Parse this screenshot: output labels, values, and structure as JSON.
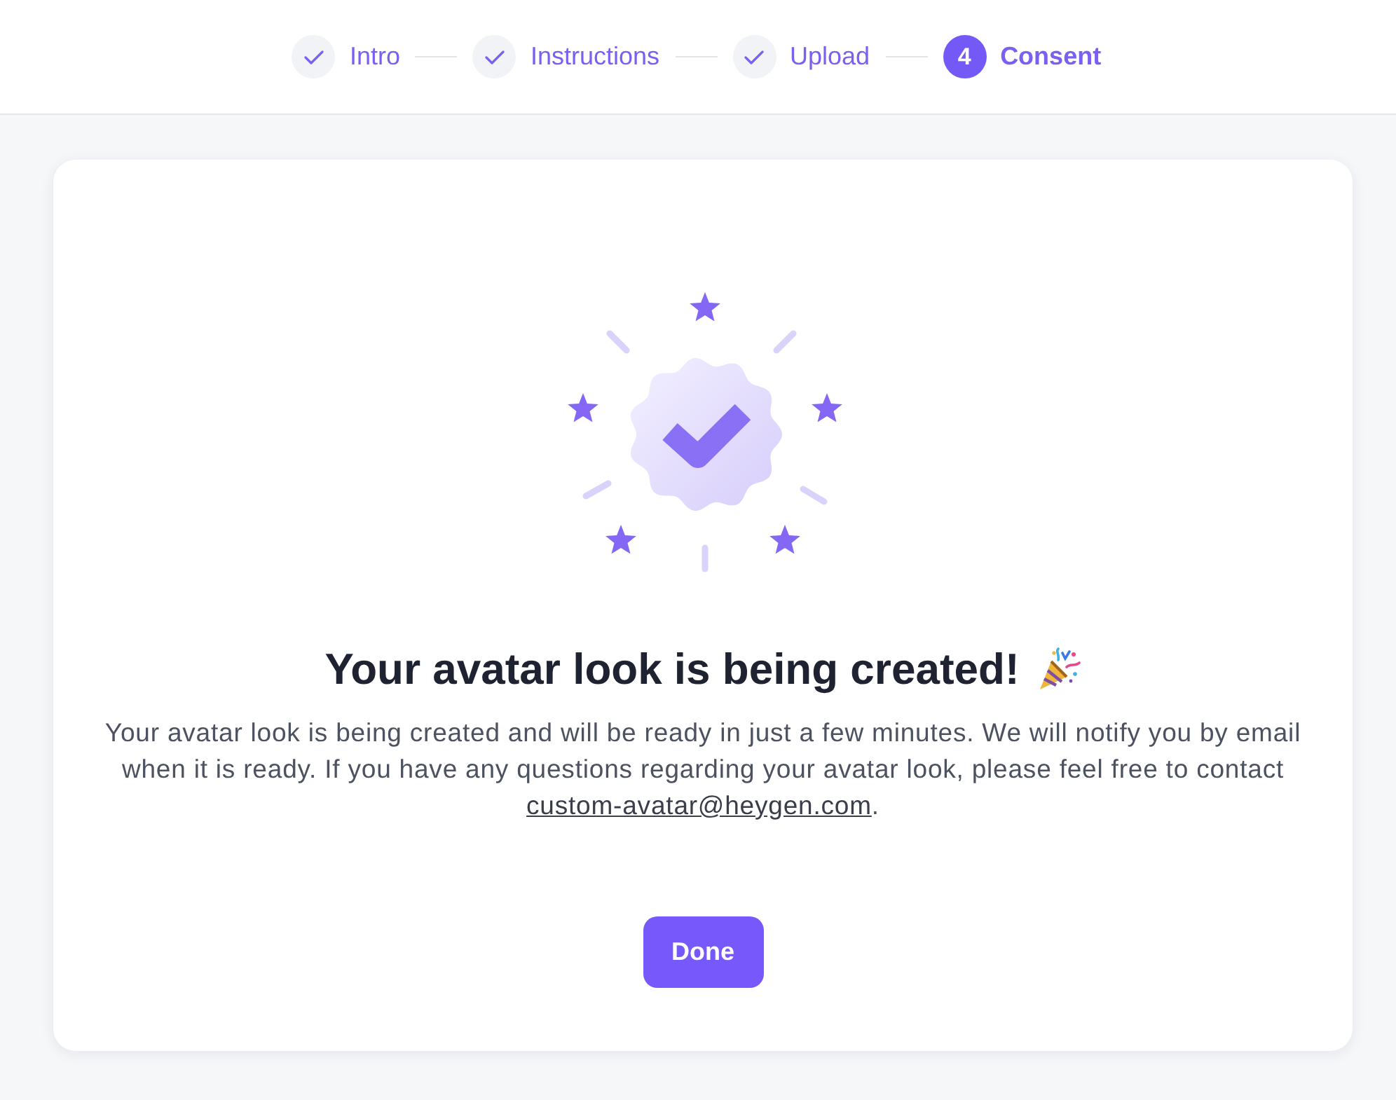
{
  "steps": [
    {
      "label": "Intro",
      "done": true,
      "selected": false
    },
    {
      "label": "Instructions",
      "done": true,
      "selected": false
    },
    {
      "label": "Upload",
      "done": true,
      "selected": false
    },
    {
      "label": "Consent",
      "number": "4",
      "done": false,
      "selected": true
    }
  ],
  "card": {
    "title": "Your avatar look is being created!",
    "message": "Your avatar look is being created and will be ready in just a few minutes. We will notify you by email when it is ready. If you have any questions regarding your avatar look, please feel free to contact",
    "link": "custom-avatar@heygen.com",
    "message_end": ".",
    "button": "Done"
  }
}
